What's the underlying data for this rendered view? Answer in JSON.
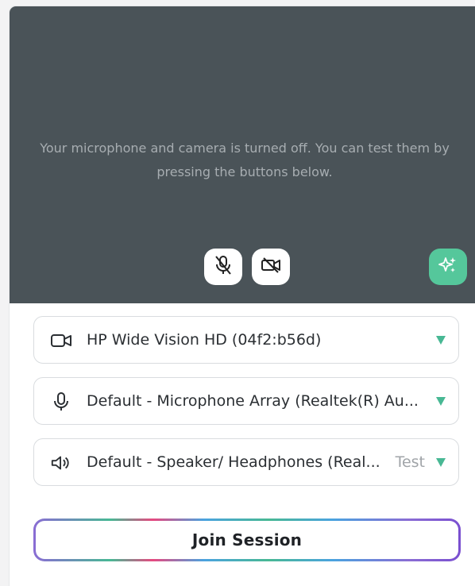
{
  "preview": {
    "message": "Your microphone and camera is turned off. You can test them by pressing the buttons below."
  },
  "icons": {
    "mic": "mic-off-icon",
    "camera": "camera-off-icon",
    "effects": "sparkle-icon",
    "video": "video-camera-icon",
    "microphone": "microphone-icon",
    "speaker": "speaker-icon",
    "dropdown": "triangle-down-icon"
  },
  "devices": {
    "camera": {
      "label": "HP Wide Vision HD (04f2:b56d)"
    },
    "microphone": {
      "label": "Default - Microphone Array  (Realtek(R) Au..."
    },
    "speaker": {
      "label": "Default - Speaker/ Headphones  (Real...",
      "test_label": "Test"
    }
  },
  "join": {
    "label": "Join Session"
  },
  "colors": {
    "preview_bg": "#4a5358",
    "accent_green": "#48b894",
    "effects_bg": "#55c79b"
  }
}
